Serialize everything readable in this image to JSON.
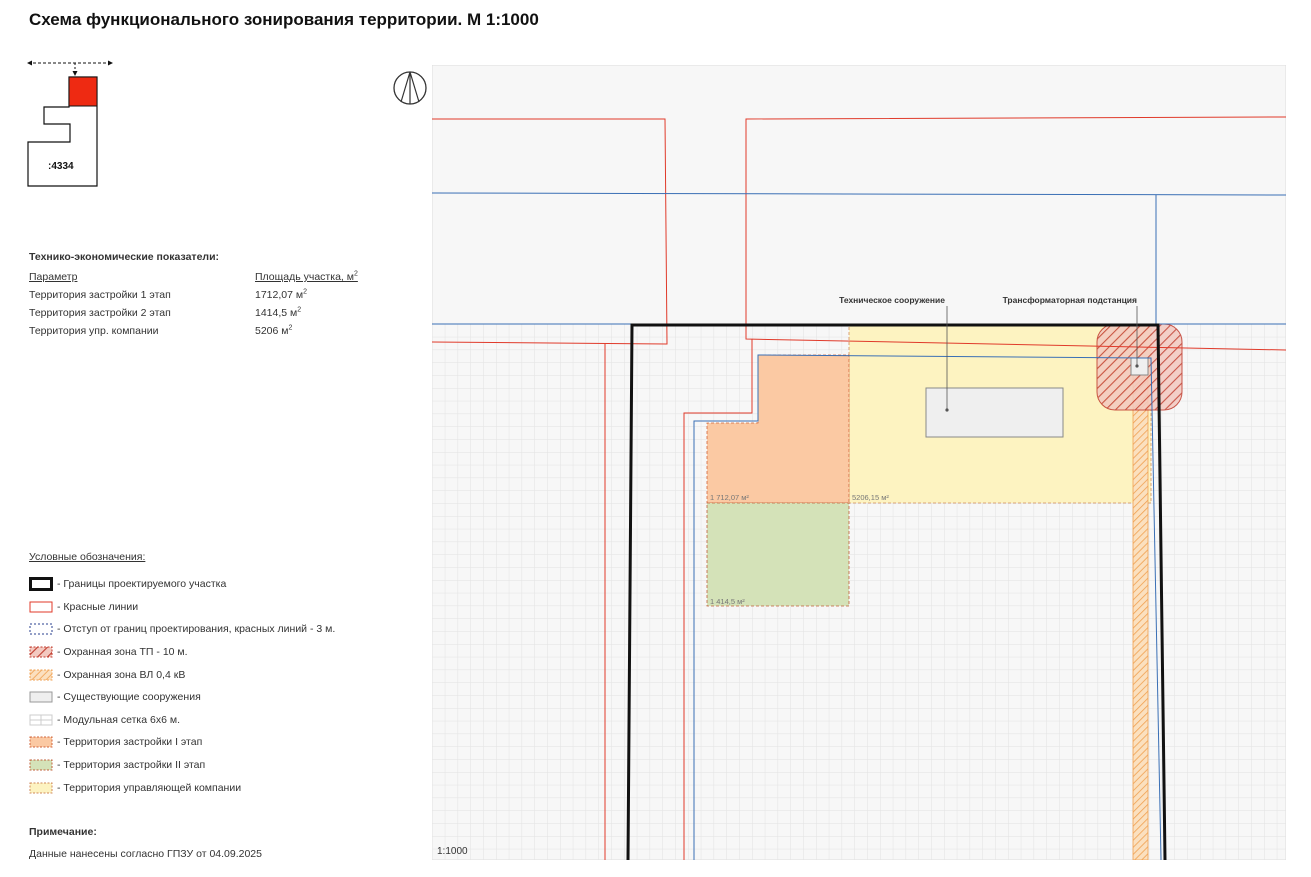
{
  "title": "Схема функционального зонирования территории. М 1:1000",
  "keymap": {
    "parcel_label": ":4334"
  },
  "tep": {
    "heading": "Технико-экономические показатели:",
    "col_param": "Параметр",
    "col_area": "Площадь участка, м",
    "col_area_sup": "2",
    "rows": [
      {
        "param": "Территория застройки 1 этап",
        "value": "1712,07 м",
        "sup": "2"
      },
      {
        "param": "Территория застройки 2 этап",
        "value": "1414,5 м",
        "sup": "2"
      },
      {
        "param": "Территория упр. компании",
        "value": "5206 м",
        "sup": "2"
      }
    ]
  },
  "legend": {
    "title": "Условные обозначения:",
    "items": [
      {
        "label": "- Границы проектируемого участка",
        "symbol": "thick-black-border"
      },
      {
        "label": "- Красные линии",
        "symbol": "red-outline"
      },
      {
        "label": "- Отступ от границ проектирования, красных линий - 3 м.",
        "symbol": "blue-dashed-outline"
      },
      {
        "label": "- Охранная зона ТП - 10 м.",
        "symbol": "red-hatch"
      },
      {
        "label": "- Охранная зона ВЛ 0,4 кВ",
        "symbol": "orange-hatch"
      },
      {
        "label": "- Существующие сооружения",
        "symbol": "grey-fill"
      },
      {
        "label": "- Модульная сетка 6х6 м.",
        "symbol": "grid"
      },
      {
        "label": "- Территория застройки I этап",
        "symbol": "orange-fill-dashed"
      },
      {
        "label": "- Территория застройки II этап",
        "symbol": "green-fill-dashed"
      },
      {
        "label": "- Территория управляющей компании",
        "symbol": "yellow-fill-dashed"
      }
    ]
  },
  "note": {
    "heading": "Примечание:",
    "text": "Данные нанесены согласно ГПЗУ от 04.09.2025"
  },
  "map": {
    "scale_label": "1:1000",
    "callout_structure": "Техническое сооружение",
    "callout_substation": "Трансформаторная подстанция",
    "area_stage1": "1 712,07 м²",
    "area_company": "5206,15 м²",
    "area_stage2": "1 414,5 м²"
  },
  "colors": {
    "red_line": "#e03a2a",
    "blue_line": "#3a6fb5",
    "stage1_fill": "#fbc9a3",
    "stage2_fill": "#d4e2b8",
    "company_fill": "#fdf3c1",
    "structure_fill": "#efefef",
    "hatch_orange": "#f0a050",
    "hatch_red": "#c0392b",
    "keymap_red": "#ee2a12"
  }
}
